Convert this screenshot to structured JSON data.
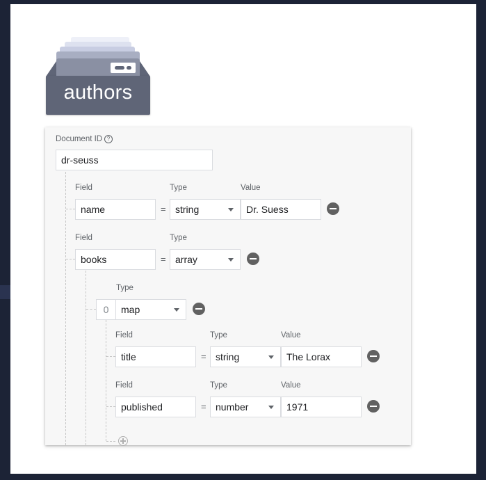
{
  "collection": {
    "name": "authors"
  },
  "document": {
    "id_label": "Document ID",
    "help_glyph": "?",
    "id_value": "dr-seuss",
    "field_label": "Field",
    "type_label": "Type",
    "value_label": "Value",
    "equals": "=",
    "fields": [
      {
        "field": "name",
        "type": "string",
        "value": "Dr. Suess"
      },
      {
        "field": "books",
        "type": "array"
      }
    ],
    "array_items": [
      {
        "index": "0",
        "type": "map"
      }
    ],
    "map_fields": [
      {
        "field": "title",
        "type": "string",
        "value": "The Lorax"
      },
      {
        "field": "published",
        "type": "number",
        "value": "1971"
      }
    ]
  },
  "colors": {
    "background": "#1c2336",
    "panel": "#ffffff",
    "collection_tray": "#5f6577",
    "remove_button": "#616161"
  },
  "icons": [
    "folder-icon",
    "help-icon",
    "remove-field-icon",
    "chevron-down-icon",
    "add-field-icon"
  ]
}
